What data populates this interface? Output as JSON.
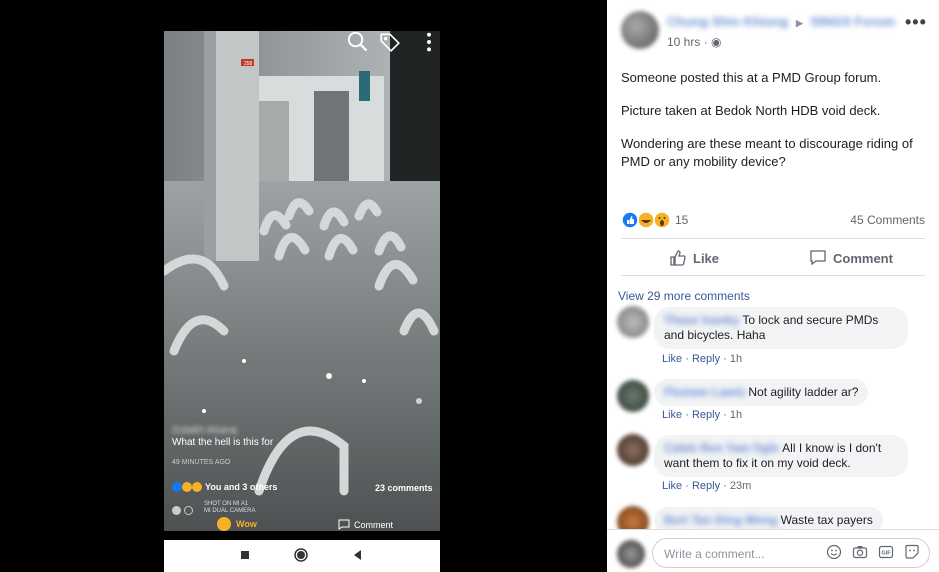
{
  "viewer": {
    "photo_caption_name": "Zulaikh Aisaraj",
    "photo_caption": "What the hell is this for",
    "photo_time": "49 MINUTES AGO",
    "photo_reactions": "You and 3 others",
    "photo_comments": "23 comments",
    "watermark_line1": "SHOT ON MI A1",
    "watermark_line2": "MI DUAL CAMERA",
    "wow_label": "Wow",
    "comment_label": "Comment",
    "sign_text": "258"
  },
  "post": {
    "author": "Chung Shin Khiong",
    "group": "SINGS Forum",
    "time": "10 hrs · ",
    "privacy_icon": "globe-icon",
    "paragraphs": [
      "Someone posted this at a PMD Group forum.",
      "Picture taken at Bedok North HDB void deck.",
      "Wondering are these meant to discourage riding of PMD or any mobility device?"
    ],
    "reaction_count": "15",
    "comments_count": "45 Comments",
    "like_label": "Like",
    "comment_label": "Comment",
    "view_more": "View 29 more comments"
  },
  "comments": [
    {
      "name": "Thase Ivanky",
      "text": "To lock and secure PMDs and bicycles. Haha",
      "like": "Like",
      "reply": "Reply",
      "time": "1h"
    },
    {
      "name": "Flumwe Lawis",
      "text": "Not agility ladder ar?",
      "like": "Like",
      "reply": "Reply",
      "time": "1h"
    },
    {
      "name": "Caleb Ren Yaw Ogle",
      "text": "All I know is I don't want them to fix it on my void deck.",
      "like": "Like",
      "reply": "Reply",
      "time": "23m"
    },
    {
      "name": "Bert Tan Ding Weng",
      "text": "Waste tax payers"
    }
  ],
  "composer": {
    "placeholder": "Write a comment..."
  },
  "colors": {
    "link": "#385898",
    "like_blue": "#1877f2",
    "meta_gray": "#606770",
    "bubble_bg": "#f2f3f5"
  }
}
